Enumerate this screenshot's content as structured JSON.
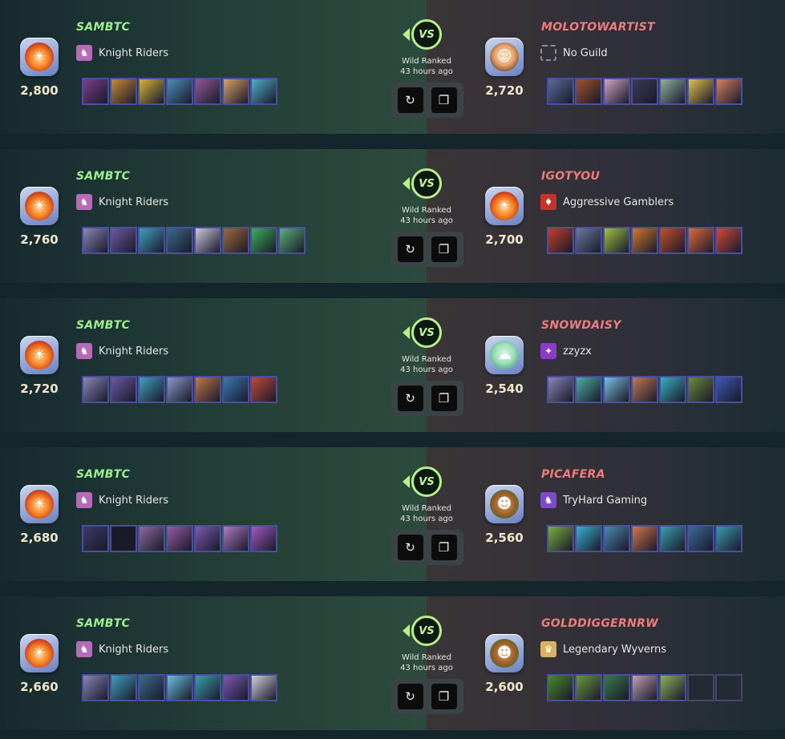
{
  "battles": [
    {
      "mode": "Wild Ranked",
      "time": "43 hours ago",
      "vs_label": "VS",
      "left": {
        "name": "SAMBTC",
        "guild": "Knight Riders",
        "rating": "2,800",
        "avatar": "flame"
      },
      "right": {
        "name": "MOLOTOWARTIST",
        "guild": "No Guild",
        "rating": "2,720",
        "avatar": "toon"
      },
      "left_cards": [
        "#7b3f8c",
        "#c78a3b",
        "#d6b53a",
        "#4d8fb8",
        "#8f5a9a",
        "#d9a06a",
        "#4fb0c8"
      ],
      "right_cards": [
        "#5a6b9a",
        "#a0532b",
        "#d2a4c0",
        "#3b3a5a",
        "#8fb0a0",
        "#e0c050",
        "#d28060"
      ]
    },
    {
      "mode": "Wild Ranked",
      "time": "43 hours ago",
      "vs_label": "VS",
      "left": {
        "name": "SAMBTC",
        "guild": "Knight Riders",
        "rating": "2,760",
        "avatar": "flame"
      },
      "right": {
        "name": "IGOTYOU",
        "guild": "Aggressive Gamblers",
        "rating": "2,700",
        "avatar": "flame"
      },
      "left_cards": [
        "#8a86b8",
        "#6a5aa0",
        "#3fa0c0",
        "#3a6a8a",
        "#c8c8d8",
        "#a06a3a",
        "#3ab05a",
        "#5ab07a"
      ],
      "right_cards": [
        "#c0402a",
        "#6a7a9a",
        "#a0c040",
        "#d07a2a",
        "#c0502a",
        "#e06a3a",
        "#d04a3a"
      ]
    },
    {
      "mode": "Wild Ranked",
      "time": "43 hours ago",
      "vs_label": "VS",
      "left": {
        "name": "SAMBTC",
        "guild": "Knight Riders",
        "rating": "2,720",
        "avatar": "flame"
      },
      "right": {
        "name": "SNOWDAISY",
        "guild": "zzyzx",
        "rating": "2,540",
        "avatar": "ghost"
      },
      "left_cards": [
        "#8a86b8",
        "#6a5aa0",
        "#3fa0c0",
        "#8a9ac8",
        "#c07a4a",
        "#3a7ab0",
        "#c04a3a"
      ],
      "right_cards": [
        "#8a86b8",
        "#4ab0a0",
        "#7ac0e0",
        "#c07a5a",
        "#3ab0c0",
        "#6a8a3a",
        "#3a5ab0"
      ]
    },
    {
      "mode": "Wild Ranked",
      "time": "43 hours ago",
      "vs_label": "VS",
      "left": {
        "name": "SAMBTC",
        "guild": "Knight Riders",
        "rating": "2,680",
        "avatar": "flame"
      },
      "right": {
        "name": "PICAFERA",
        "guild": "TryHard Gaming",
        "rating": "2,560",
        "avatar": "goblin"
      },
      "left_cards": [
        "#3a3a6a",
        "#1a1a2a",
        "#8a6aa0",
        "#9a5aa0",
        "#7a5ab0",
        "#b07ac0",
        "#a05ac0"
      ],
      "right_cards": [
        "#7ab040",
        "#3ab0d0",
        "#4a8ab0",
        "#d07a4a",
        "#3aa0b0",
        "#3a6a9a",
        "#3a9ab0"
      ]
    },
    {
      "mode": "Wild Ranked",
      "time": "43 hours ago",
      "vs_label": "VS",
      "left": {
        "name": "SAMBTC",
        "guild": "Knight Riders",
        "rating": "2,660",
        "avatar": "flame"
      },
      "right": {
        "name": "GOLDDIGGERNRW",
        "guild": "Legendary Wyverns",
        "rating": "2,600",
        "avatar": "goblin"
      },
      "left_cards": [
        "#8a86b8",
        "#3fa0c0",
        "#3a6a8a",
        "#6ac0e0",
        "#3aa0b0",
        "#7a5ab0",
        "#d0d0d8"
      ],
      "right_cards": [
        "#4a8a2a",
        "#6a9a3a",
        "#3a7a4a",
        "#c0a0b0",
        "#8ab05a",
        "",
        ""
      ]
    }
  ]
}
